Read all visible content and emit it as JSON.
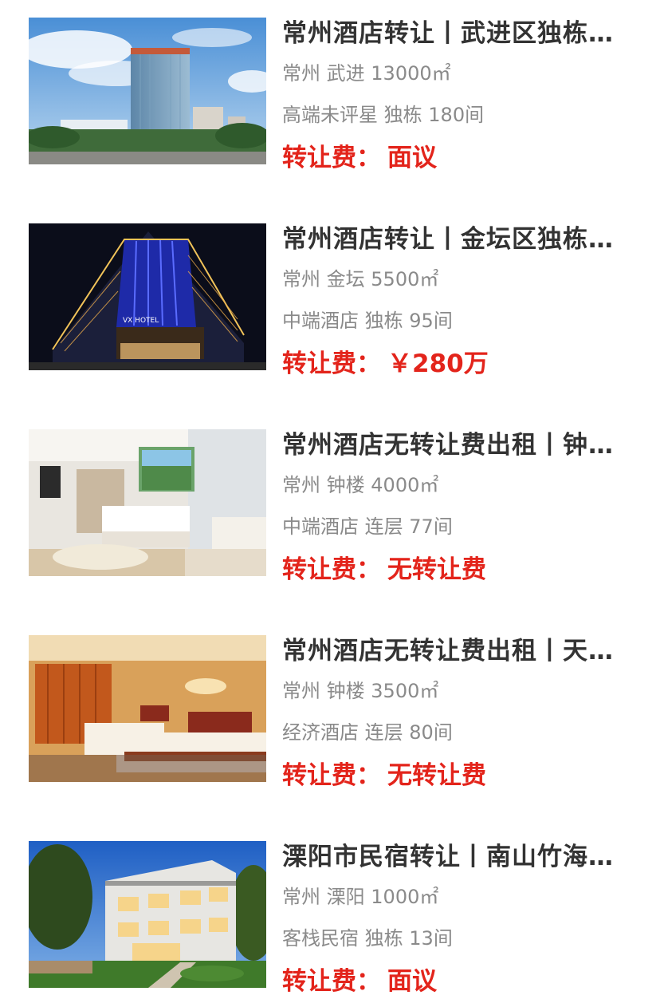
{
  "colors": {
    "title": "#333333",
    "meta": "#8a8a8a",
    "fee": "#e3241b"
  },
  "listings": [
    {
      "title": "常州酒店转让丨武进区独栋…",
      "city": "常州",
      "district": "武进",
      "area": "13000㎡",
      "grade": "高端未评星",
      "building": "独栋",
      "rooms": "180间",
      "fee_label": "转让费：",
      "fee_value": "面议",
      "image": "hotel-tower-daytime-photo"
    },
    {
      "title": "常州酒店转让丨金坛区独栋…",
      "city": "常州",
      "district": "金坛",
      "area": "5500㎡",
      "grade": "中端酒店",
      "building": "独栋",
      "rooms": "95间",
      "fee_label": "转让费：",
      "fee_value": "￥280万",
      "image": "hotel-night-lights-photo"
    },
    {
      "title": "常州酒店无转让费出租丨钟…",
      "city": "常州",
      "district": "钟楼",
      "area": "4000㎡",
      "grade": "中端酒店",
      "building": "连层",
      "rooms": "77间",
      "fee_label": "转让费：",
      "fee_value": "无转让费",
      "image": "hotel-room-bright-photo"
    },
    {
      "title": "常州酒店无转让费出租丨天…",
      "city": "常州",
      "district": "钟楼",
      "area": "3500㎡",
      "grade": "经济酒店",
      "building": "连层",
      "rooms": "80间",
      "fee_label": "转让费：",
      "fee_value": "无转让费",
      "image": "hotel-room-warm-photo"
    },
    {
      "title": "溧阳市民宿转让丨南山竹海…",
      "city": "常州",
      "district": "溧阳",
      "area": "1000㎡",
      "grade": "客栈民宿",
      "building": "独栋",
      "rooms": "13间",
      "fee_label": "转让费：",
      "fee_value": "面议",
      "image": "guesthouse-dusk-photo"
    }
  ]
}
